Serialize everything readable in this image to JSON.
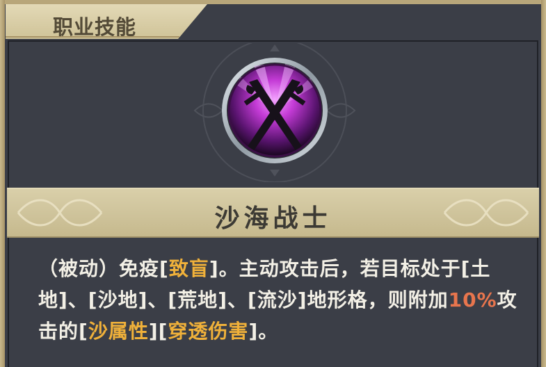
{
  "tab": {
    "label": "职业技能"
  },
  "skill": {
    "name": "沙海战士",
    "icon": "crossed-blades-icon",
    "description": {
      "p1": "（被动）免疫[",
      "k1": "致盲",
      "p2": "]。主动攻击后，若目标处于[土地]、[沙地]、[荒地]、[流沙]地形格，则附加",
      "k2": "10%",
      "p3": "攻击的[",
      "k3": "沙属性",
      "p4": "][",
      "k4": "穿透伤害",
      "p5": "]。"
    }
  },
  "colors": {
    "panel": "#3b3e47",
    "gold_frame": "#c9b98d",
    "highlight": "#f0b13a",
    "percent": "#e8754d",
    "icon_glow": "#c43bd6"
  }
}
